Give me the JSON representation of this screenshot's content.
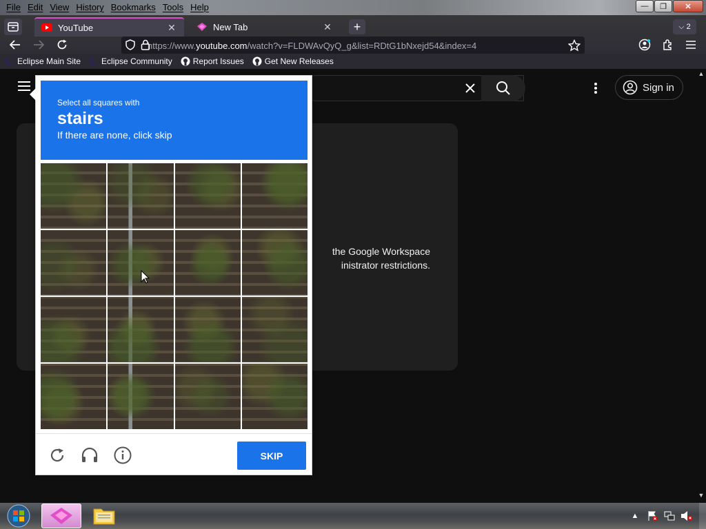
{
  "menubar": {
    "items": [
      "File",
      "Edit",
      "View",
      "History",
      "Bookmarks",
      "Tools",
      "Help"
    ]
  },
  "window_controls": {
    "minimize": "—",
    "maximize": "❐",
    "close": "✕"
  },
  "tabs": [
    {
      "title": "YouTube",
      "active": true,
      "close": "✕"
    },
    {
      "title": "New Tab",
      "active": false,
      "close": "✕"
    }
  ],
  "new_tab": "+",
  "tab_overflow": {
    "count": "2"
  },
  "url": {
    "prefix": "https://www.",
    "host": "youtube.com",
    "path": "/watch?v=FLDWAvQyQ_g&list=RDtG1bNxejd54&index=4"
  },
  "bookmarks": [
    "Eclipse Main Site",
    "Eclipse Community",
    "Report Issues",
    "Get New Releases"
  ],
  "youtube": {
    "signin": "Sign in",
    "player_message_line1": "the Google Workspace",
    "player_message_line2": "inistrator restrictions."
  },
  "captcha": {
    "instruction_small": "Select all squares with",
    "keyword": "stairs",
    "instruction_sub": "If there are none, click skip",
    "skip_label": "SKIP",
    "grid_rows": 4,
    "grid_cols": 4
  },
  "colors": {
    "captcha_blue": "#1a73e8",
    "tab_accent": "#e14ecb"
  }
}
